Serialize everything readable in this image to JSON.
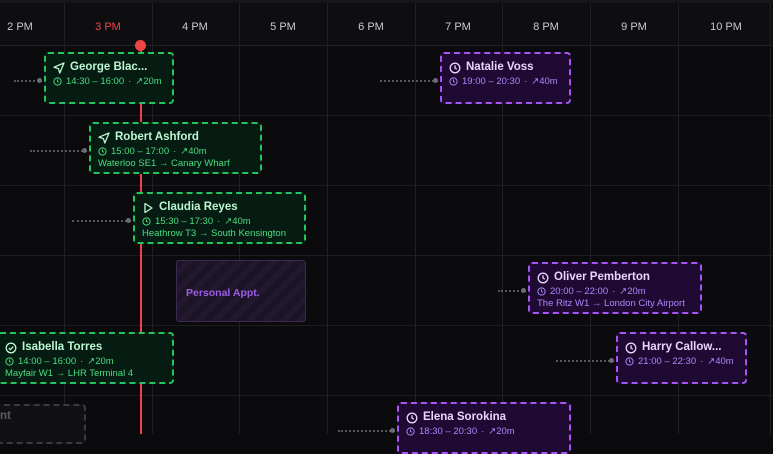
{
  "timeline": {
    "hours": [
      "2 PM",
      "3 PM",
      "4 PM",
      "5 PM",
      "6 PM",
      "7 PM",
      "8 PM",
      "9 PM",
      "10 PM"
    ],
    "current_hour_label": "3 PM"
  },
  "colors": {
    "now": "#ef4444",
    "green": "#22c55e",
    "purple": "#a855f7"
  },
  "bookings": [
    {
      "name": "George Blac...",
      "time": "14:30 – 16:00",
      "duration": "↗20m",
      "route": "",
      "status_icon": "navigation-arrow-icon",
      "color": "green"
    },
    {
      "name": "Natalie Voss",
      "time": "19:00 – 20:30",
      "duration": "↗40m",
      "route": "",
      "status_icon": "clock-icon",
      "color": "purple"
    },
    {
      "name": "Robert Ashford",
      "time": "15:00 – 17:00",
      "duration": "↗40m",
      "route": "Waterloo SE1 → Canary Wharf",
      "status_icon": "navigation-arrow-icon",
      "color": "green"
    },
    {
      "name": "Claudia Reyes",
      "time": "15:30 – 17:30",
      "duration": "↗40m",
      "route": "Heathrow T3 → South Kensington",
      "status_icon": "play-icon",
      "color": "green"
    },
    {
      "name": "Oliver Pemberton",
      "time": "20:00 – 22:00",
      "duration": "↗20m",
      "route": "The Ritz W1 → London City Airport",
      "status_icon": "clock-icon",
      "color": "purple"
    },
    {
      "name": "Isabella Torres",
      "time": "14:00 – 16:00",
      "duration": "↗20m",
      "route": "Mayfair W1 → LHR Terminal 4",
      "status_icon": "check-circle-icon",
      "color": "green"
    },
    {
      "name": "Harry Callow...",
      "time": "21:00 – 22:30",
      "duration": "↗40m",
      "route": "",
      "status_icon": "clock-icon",
      "color": "purple"
    },
    {
      "name": "Elena Sorokina",
      "time": "18:30 – 20:30",
      "duration": "↗20m",
      "route": "",
      "status_icon": "clock-icon",
      "color": "purple"
    }
  ],
  "personal_block": {
    "label": "Personal Appt."
  },
  "ghost_block": {
    "label": "nt"
  }
}
